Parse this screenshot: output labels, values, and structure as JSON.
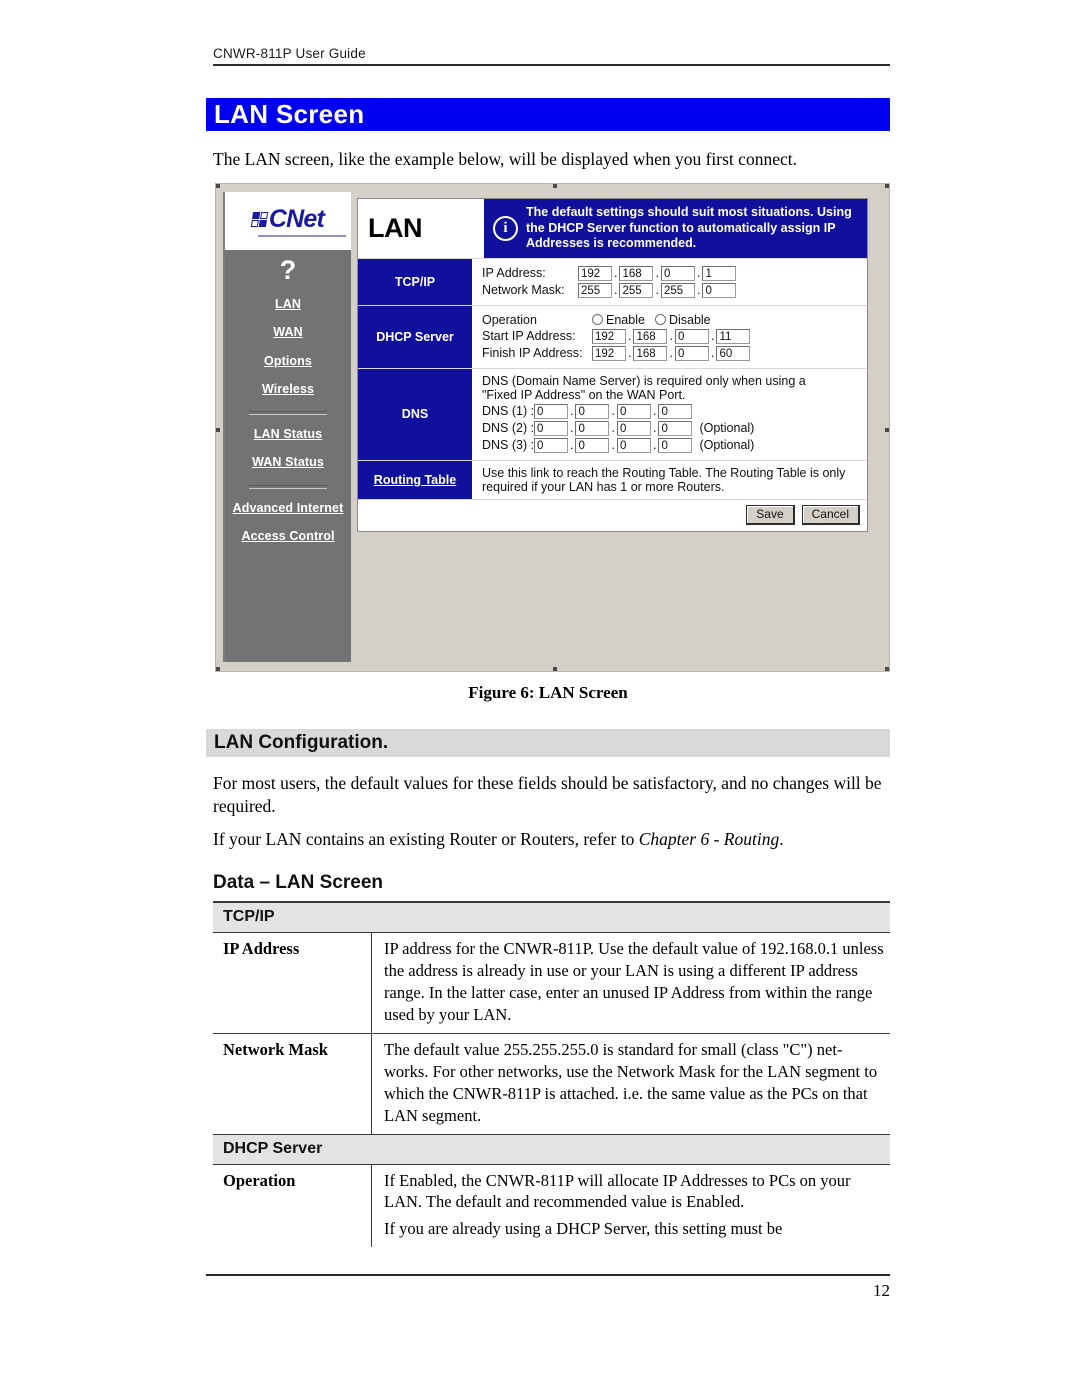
{
  "header": {
    "running_head": "CNWR-811P User Guide"
  },
  "headings": {
    "chapter_title": "LAN Screen",
    "section_title": "LAN Configuration.",
    "subsection_title": "Data – LAN Screen"
  },
  "intro_text": "The LAN screen, like the example below, will be displayed when you first connect.",
  "figure": {
    "caption": "Figure 6: LAN Screen",
    "logo_word": "CNet",
    "help_icon": "?",
    "sidebar": [
      {
        "label": "LAN"
      },
      {
        "label": "WAN"
      },
      {
        "label": "Options"
      },
      {
        "label": "Wireless"
      },
      {
        "label": "LAN Status"
      },
      {
        "label": "WAN Status"
      },
      {
        "label": "Advanced Internet"
      },
      {
        "label": "Access Control"
      }
    ],
    "page_title": "LAN",
    "info_banner": "The default settings should suit most situations. Using the DHCP Server function to automatically assign IP Addresses is recommended.",
    "info_icon": "i",
    "sections": {
      "tcpip": {
        "label": "TCP/IP",
        "ip_address_label": "IP Address:",
        "ip_address": [
          "192",
          "168",
          "0",
          "1"
        ],
        "network_mask_label": "Network Mask:",
        "network_mask": [
          "255",
          "255",
          "255",
          "0"
        ]
      },
      "dhcp": {
        "label": "DHCP Server",
        "operation_label": "Operation",
        "enable_label": "Enable",
        "disable_label": "Disable",
        "start_label": "Start IP Address:",
        "start_ip": [
          "192",
          "168",
          "0",
          "11"
        ],
        "finish_label": "Finish IP Address:",
        "finish_ip": [
          "192",
          "168",
          "0",
          "60"
        ]
      },
      "dns": {
        "label": "DNS",
        "note_line1": "DNS (Domain Name Server) is required only when using a",
        "note_line2": "\"Fixed IP Address\" on the WAN Port.",
        "rows": [
          {
            "label": "DNS (1) :",
            "values": [
              "0",
              "0",
              "0",
              "0"
            ],
            "optional": ""
          },
          {
            "label": "DNS (2) :",
            "values": [
              "0",
              "0",
              "0",
              "0"
            ],
            "optional": "(Optional)"
          },
          {
            "label": "DNS (3) :",
            "values": [
              "0",
              "0",
              "0",
              "0"
            ],
            "optional": "(Optional)"
          }
        ]
      },
      "routing": {
        "label": "Routing Table",
        "note_line1": "Use this link to reach the Routing Table. The Routing Table is only",
        "note_line2": "required if your LAN has 1 or more Routers."
      }
    },
    "buttons": {
      "save": "Save",
      "cancel": "Cancel"
    }
  },
  "body": {
    "para1": "For most users, the default values for these fields should be satisfactory, and no changes will be required.",
    "para2_prefix": "If your LAN contains an existing Router or Routers, refer to ",
    "para2_italic": "Chapter 6 - Routing",
    "para2_suffix": "."
  },
  "data_table": {
    "sections": [
      {
        "title": "TCP/IP",
        "rows": [
          {
            "key": "IP Address",
            "paragraphs": [
              "IP address for the CNWR-811P. Use the default value of 192.168.0.1 unless the address is already in use or your LAN is using a different IP address range. In the latter case, enter an unused IP Address from within the range used by your LAN."
            ]
          },
          {
            "key": "Network Mask",
            "paragraphs": [
              "The default value 255.255.255.0 is standard for small (class \"C\") net-works. For other networks, use the Network Mask for the LAN segment to which the CNWR-811P is attached. i.e. the same value as the PCs on that LAN segment."
            ]
          }
        ]
      },
      {
        "title": "DHCP Server",
        "rows": [
          {
            "key": "Operation",
            "paragraphs": [
              "If Enabled, the CNWR-811P will allocate IP Addresses to PCs on your LAN. The default and recommended value is Enabled.",
              "If you are already using a DHCP Server, this setting must be"
            ]
          }
        ]
      }
    ]
  },
  "footer": {
    "page_number": "12"
  }
}
